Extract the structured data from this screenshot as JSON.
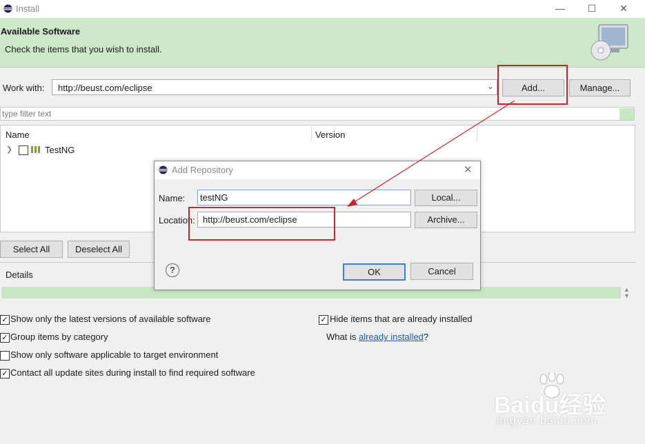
{
  "window": {
    "title": "Install",
    "controls": [
      "minimize-icon",
      "maximize-icon",
      "close-icon"
    ]
  },
  "banner": {
    "title": "Available Software",
    "subtitle": "Check the items that you wish to install."
  },
  "work_with": {
    "label": "Work with:",
    "value": "http://beust.com/eclipse",
    "add_label": "Add...",
    "manage_label": "Manage..."
  },
  "filter": {
    "placeholder": "type filter text"
  },
  "tree": {
    "columns": [
      "Name",
      "Version"
    ],
    "rows": [
      {
        "label": "TestNG",
        "checked": false,
        "expanded": false
      }
    ]
  },
  "selection": {
    "select_all": "Select All",
    "deselect_all": "Deselect All"
  },
  "details": {
    "label": "Details"
  },
  "options": {
    "latest_versions": "Show only the latest versions of available software",
    "group_by_category": "Group items by category",
    "target_env": "Show only software applicable to target environment",
    "contact_sites": "Contact all update sites during install to find required software",
    "hide_installed": "Hide items that are already installed",
    "what_is_prefix": "What is ",
    "what_is_link": "already installed",
    "what_is_suffix": "?"
  },
  "dialog": {
    "title": "Add Repository",
    "name_label": "Name:",
    "name_value": "testNG",
    "location_label": "Location:",
    "location_value": "http://beust.com/eclipse",
    "local_label": "Local...",
    "archive_label": "Archive...",
    "ok_label": "OK",
    "cancel_label": "Cancel"
  },
  "watermark": {
    "text": "Baidu经验",
    "sub": "jingyan.baidu.com"
  },
  "colors": {
    "banner": "#cde8c9",
    "annotation": "#d0212a",
    "link": "#1a5fb4"
  }
}
